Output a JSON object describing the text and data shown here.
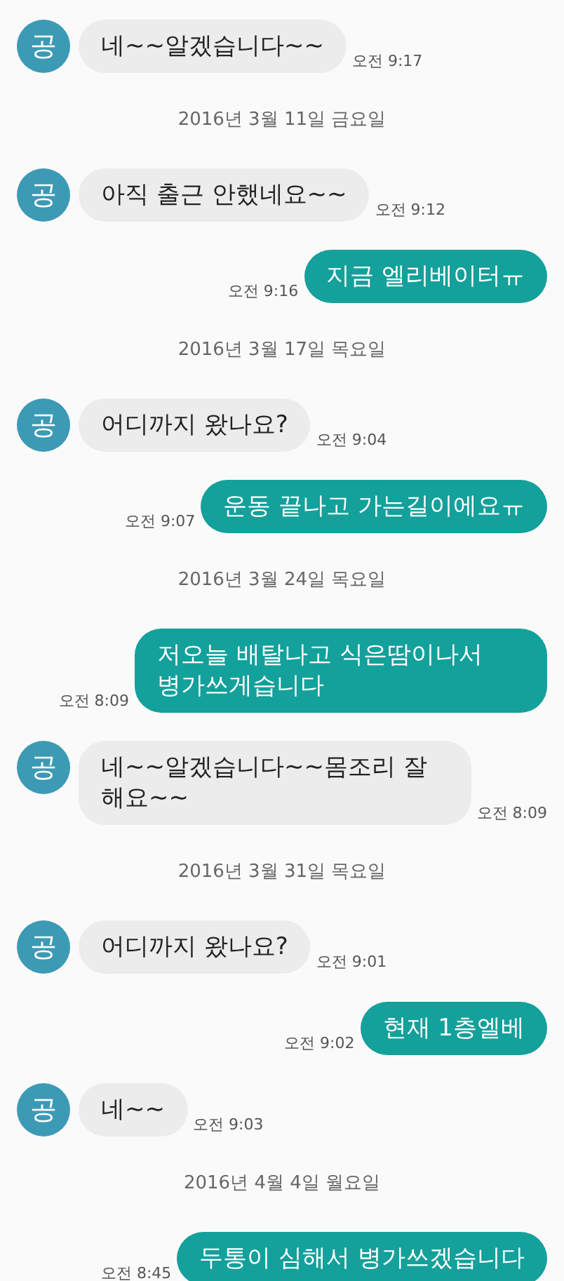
{
  "messages": [
    {
      "kind": "in",
      "avatar": "공",
      "text": "네~~알겠습니다~~",
      "time": "오전 9:17"
    },
    {
      "kind": "date",
      "text": "2016년 3월 11일 금요일"
    },
    {
      "kind": "in",
      "avatar": "공",
      "text": "아직 출근 안했네요~~",
      "time": "오전 9:12"
    },
    {
      "kind": "out",
      "text": "지금 엘리베이터ㅠ",
      "time": "오전 9:16"
    },
    {
      "kind": "date",
      "text": "2016년 3월 17일 목요일"
    },
    {
      "kind": "in",
      "avatar": "공",
      "text": "어디까지 왔나요?",
      "time": "오전 9:04"
    },
    {
      "kind": "out",
      "text": "운동 끝나고 가는길이에요ㅠ",
      "time": "오전 9:07"
    },
    {
      "kind": "date",
      "text": "2016년 3월 24일 목요일"
    },
    {
      "kind": "out",
      "text": "저오늘 배탈나고 식은땀이나서 병가쓰게습니다",
      "time": "오전 8:09"
    },
    {
      "kind": "in",
      "avatar": "공",
      "text": "네~~알겠습니다~~몸조리 잘 해요~~",
      "time": "오전 8:09"
    },
    {
      "kind": "date",
      "text": "2016년 3월 31일 목요일"
    },
    {
      "kind": "in",
      "avatar": "공",
      "text": "어디까지 왔나요?",
      "time": "오전 9:01"
    },
    {
      "kind": "out",
      "text": "현재 1층엘베",
      "time": "오전 9:02"
    },
    {
      "kind": "in",
      "avatar": "공",
      "text": "네~~",
      "time": "오전 9:03"
    },
    {
      "kind": "date",
      "text": "2016년 4월 4일 월요일"
    },
    {
      "kind": "out",
      "text": "두통이 심해서 병가쓰겠습니다",
      "time": "오전 8:45"
    }
  ]
}
